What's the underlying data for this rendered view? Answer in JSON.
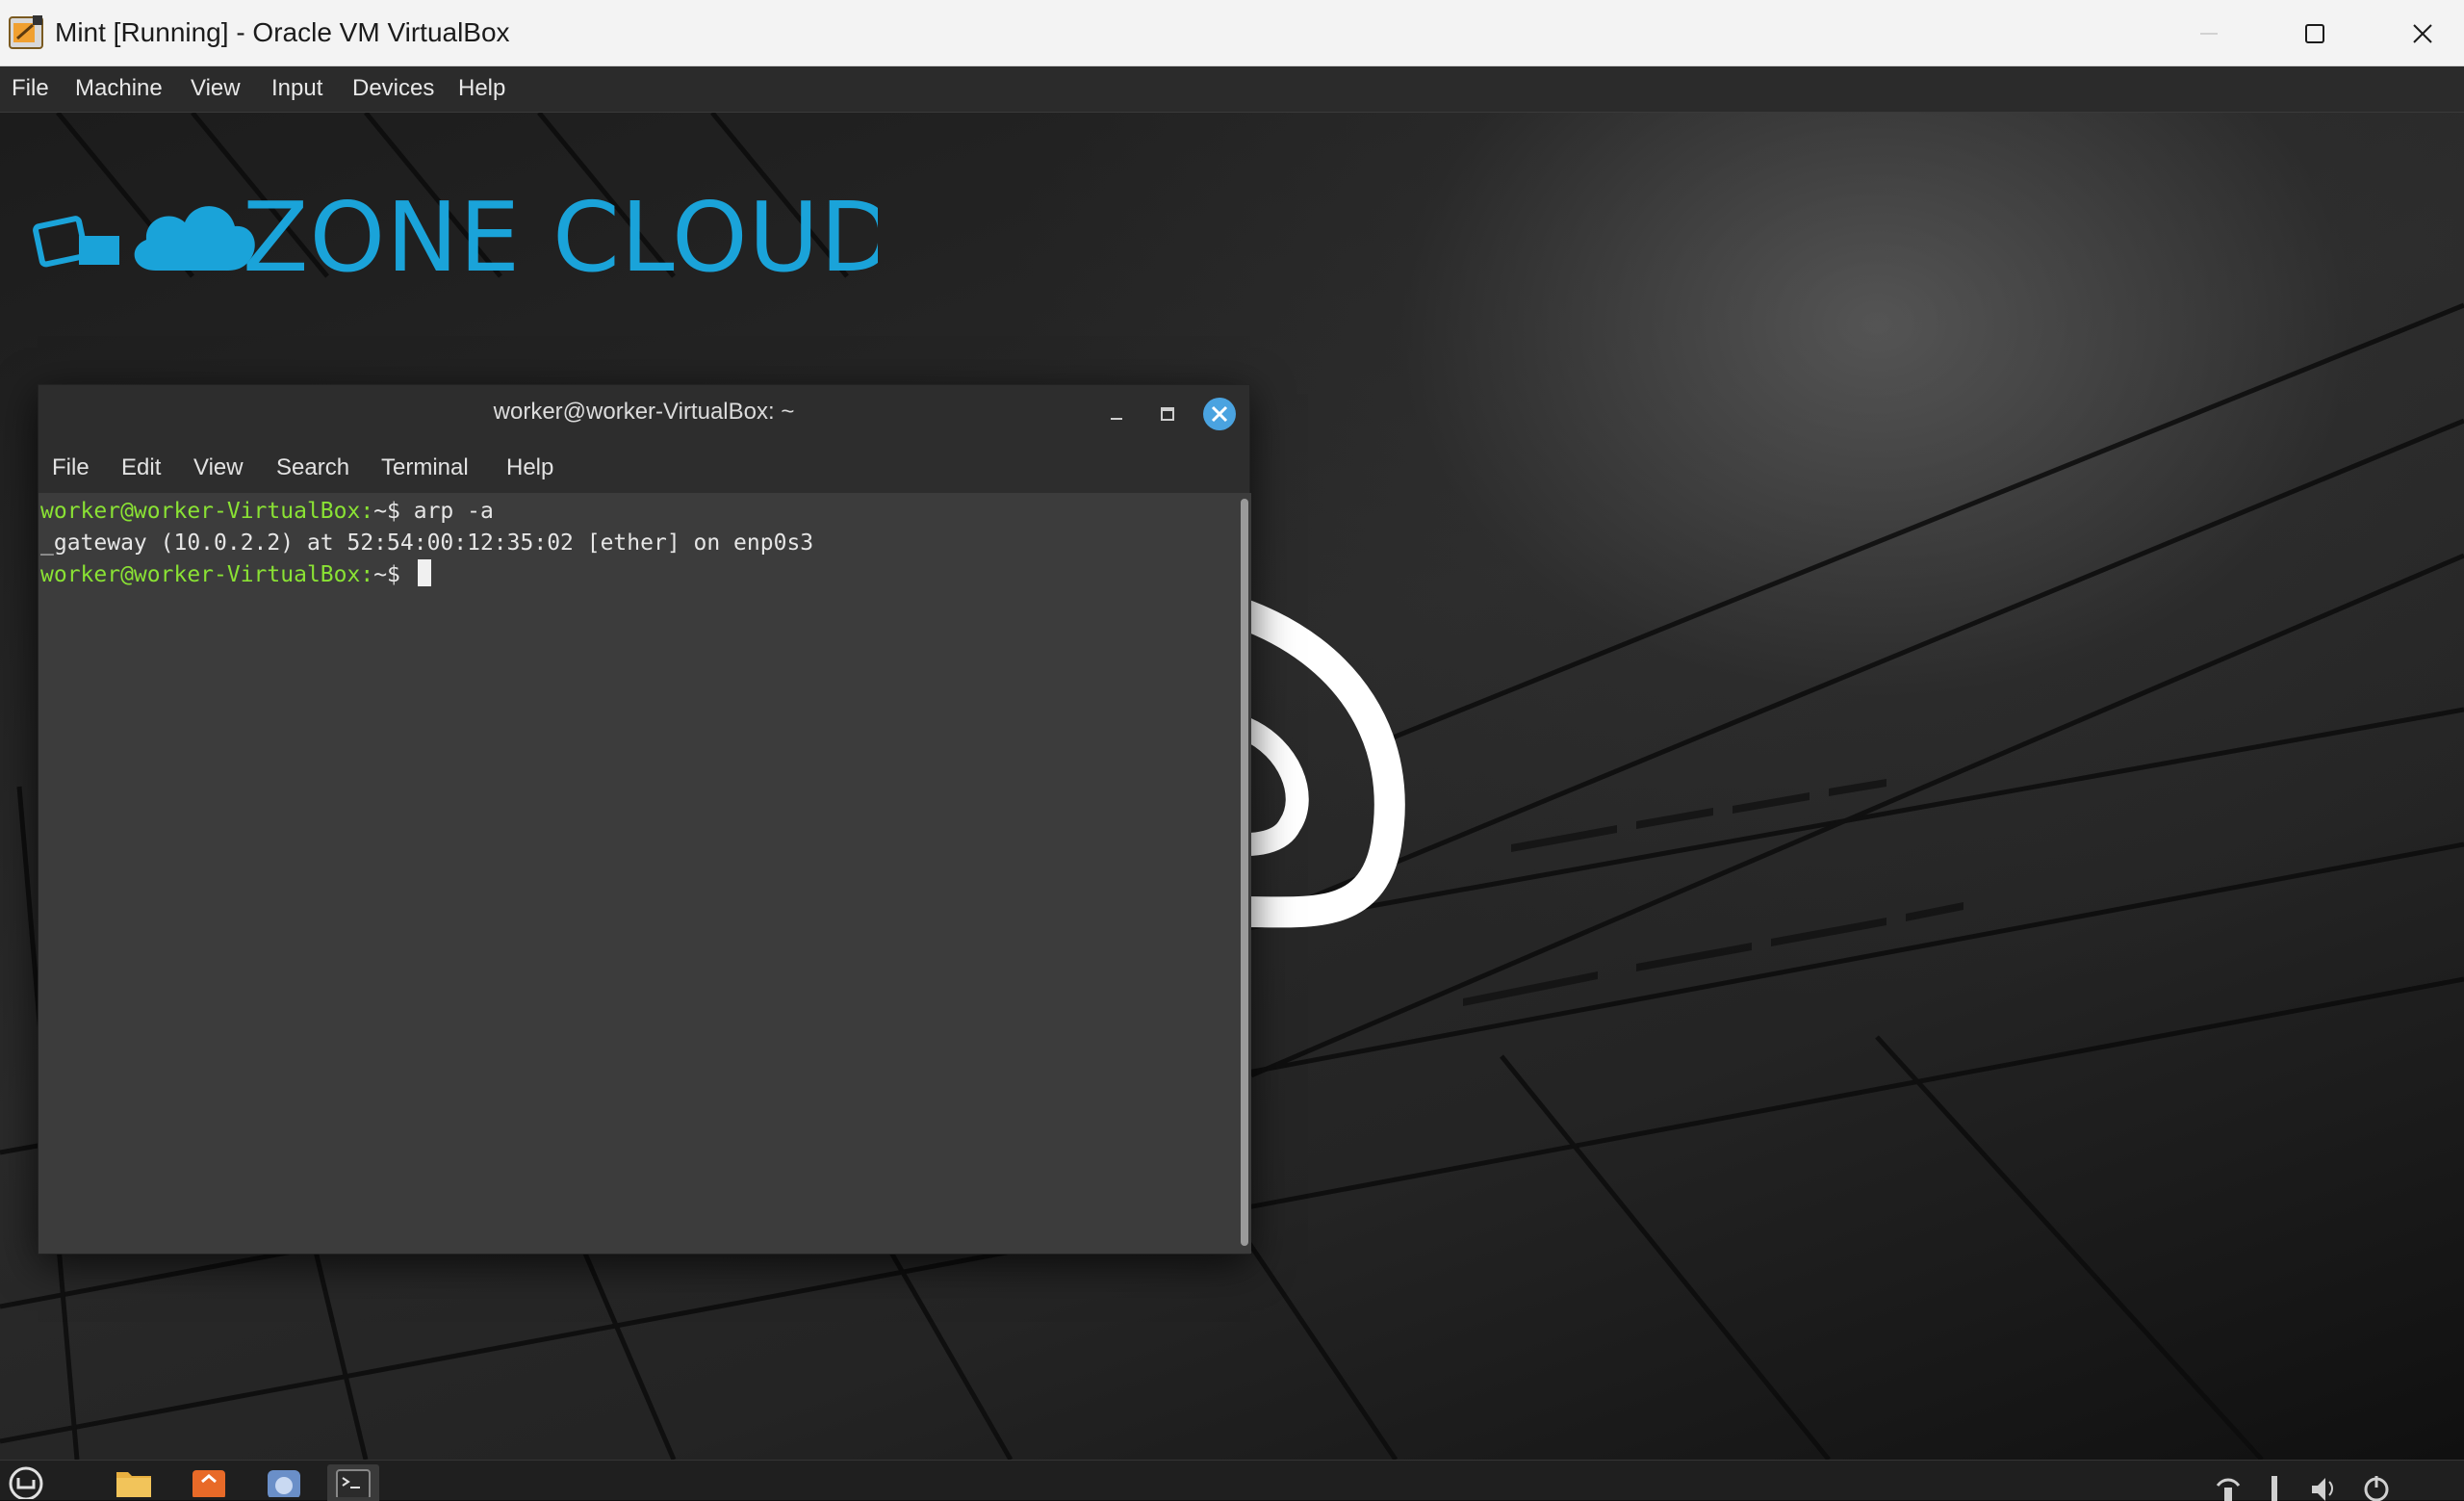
{
  "host_window": {
    "title": "Mint [Running] - Oracle VM VirtualBox",
    "controls": [
      "minimize",
      "maximize",
      "close"
    ]
  },
  "vbox_menu": {
    "items": [
      "File",
      "Machine",
      "View",
      "Input",
      "Devices",
      "Help"
    ]
  },
  "watermark": {
    "text": "ZONE CLOUD",
    "color": "#1aa3d9"
  },
  "terminal": {
    "title": "worker@worker-VirtualBox: ~",
    "menu": [
      "File",
      "Edit",
      "View",
      "Search",
      "Terminal",
      "Help"
    ],
    "lines": [
      {
        "prompt": "worker@worker-VirtualBox:",
        "suffix": "~$ arp -a"
      },
      {
        "output": "_gateway (10.0.2.2) at 52:54:00:12:35:02 [ether] on enp0s3"
      },
      {
        "prompt": "worker@worker-VirtualBox:",
        "suffix": "~$ "
      }
    ],
    "prompt_color": "#8ae234",
    "close_button_color": "#4aa3e0"
  },
  "taskbar": {
    "items": [
      "menu",
      "files",
      "software-manager",
      "browser",
      "terminal"
    ],
    "active": "terminal"
  },
  "colors": {
    "desktop_background": "#1c1c1c",
    "terminal_background": "#3c3c3c",
    "titlebar": "#2d2d2d"
  }
}
